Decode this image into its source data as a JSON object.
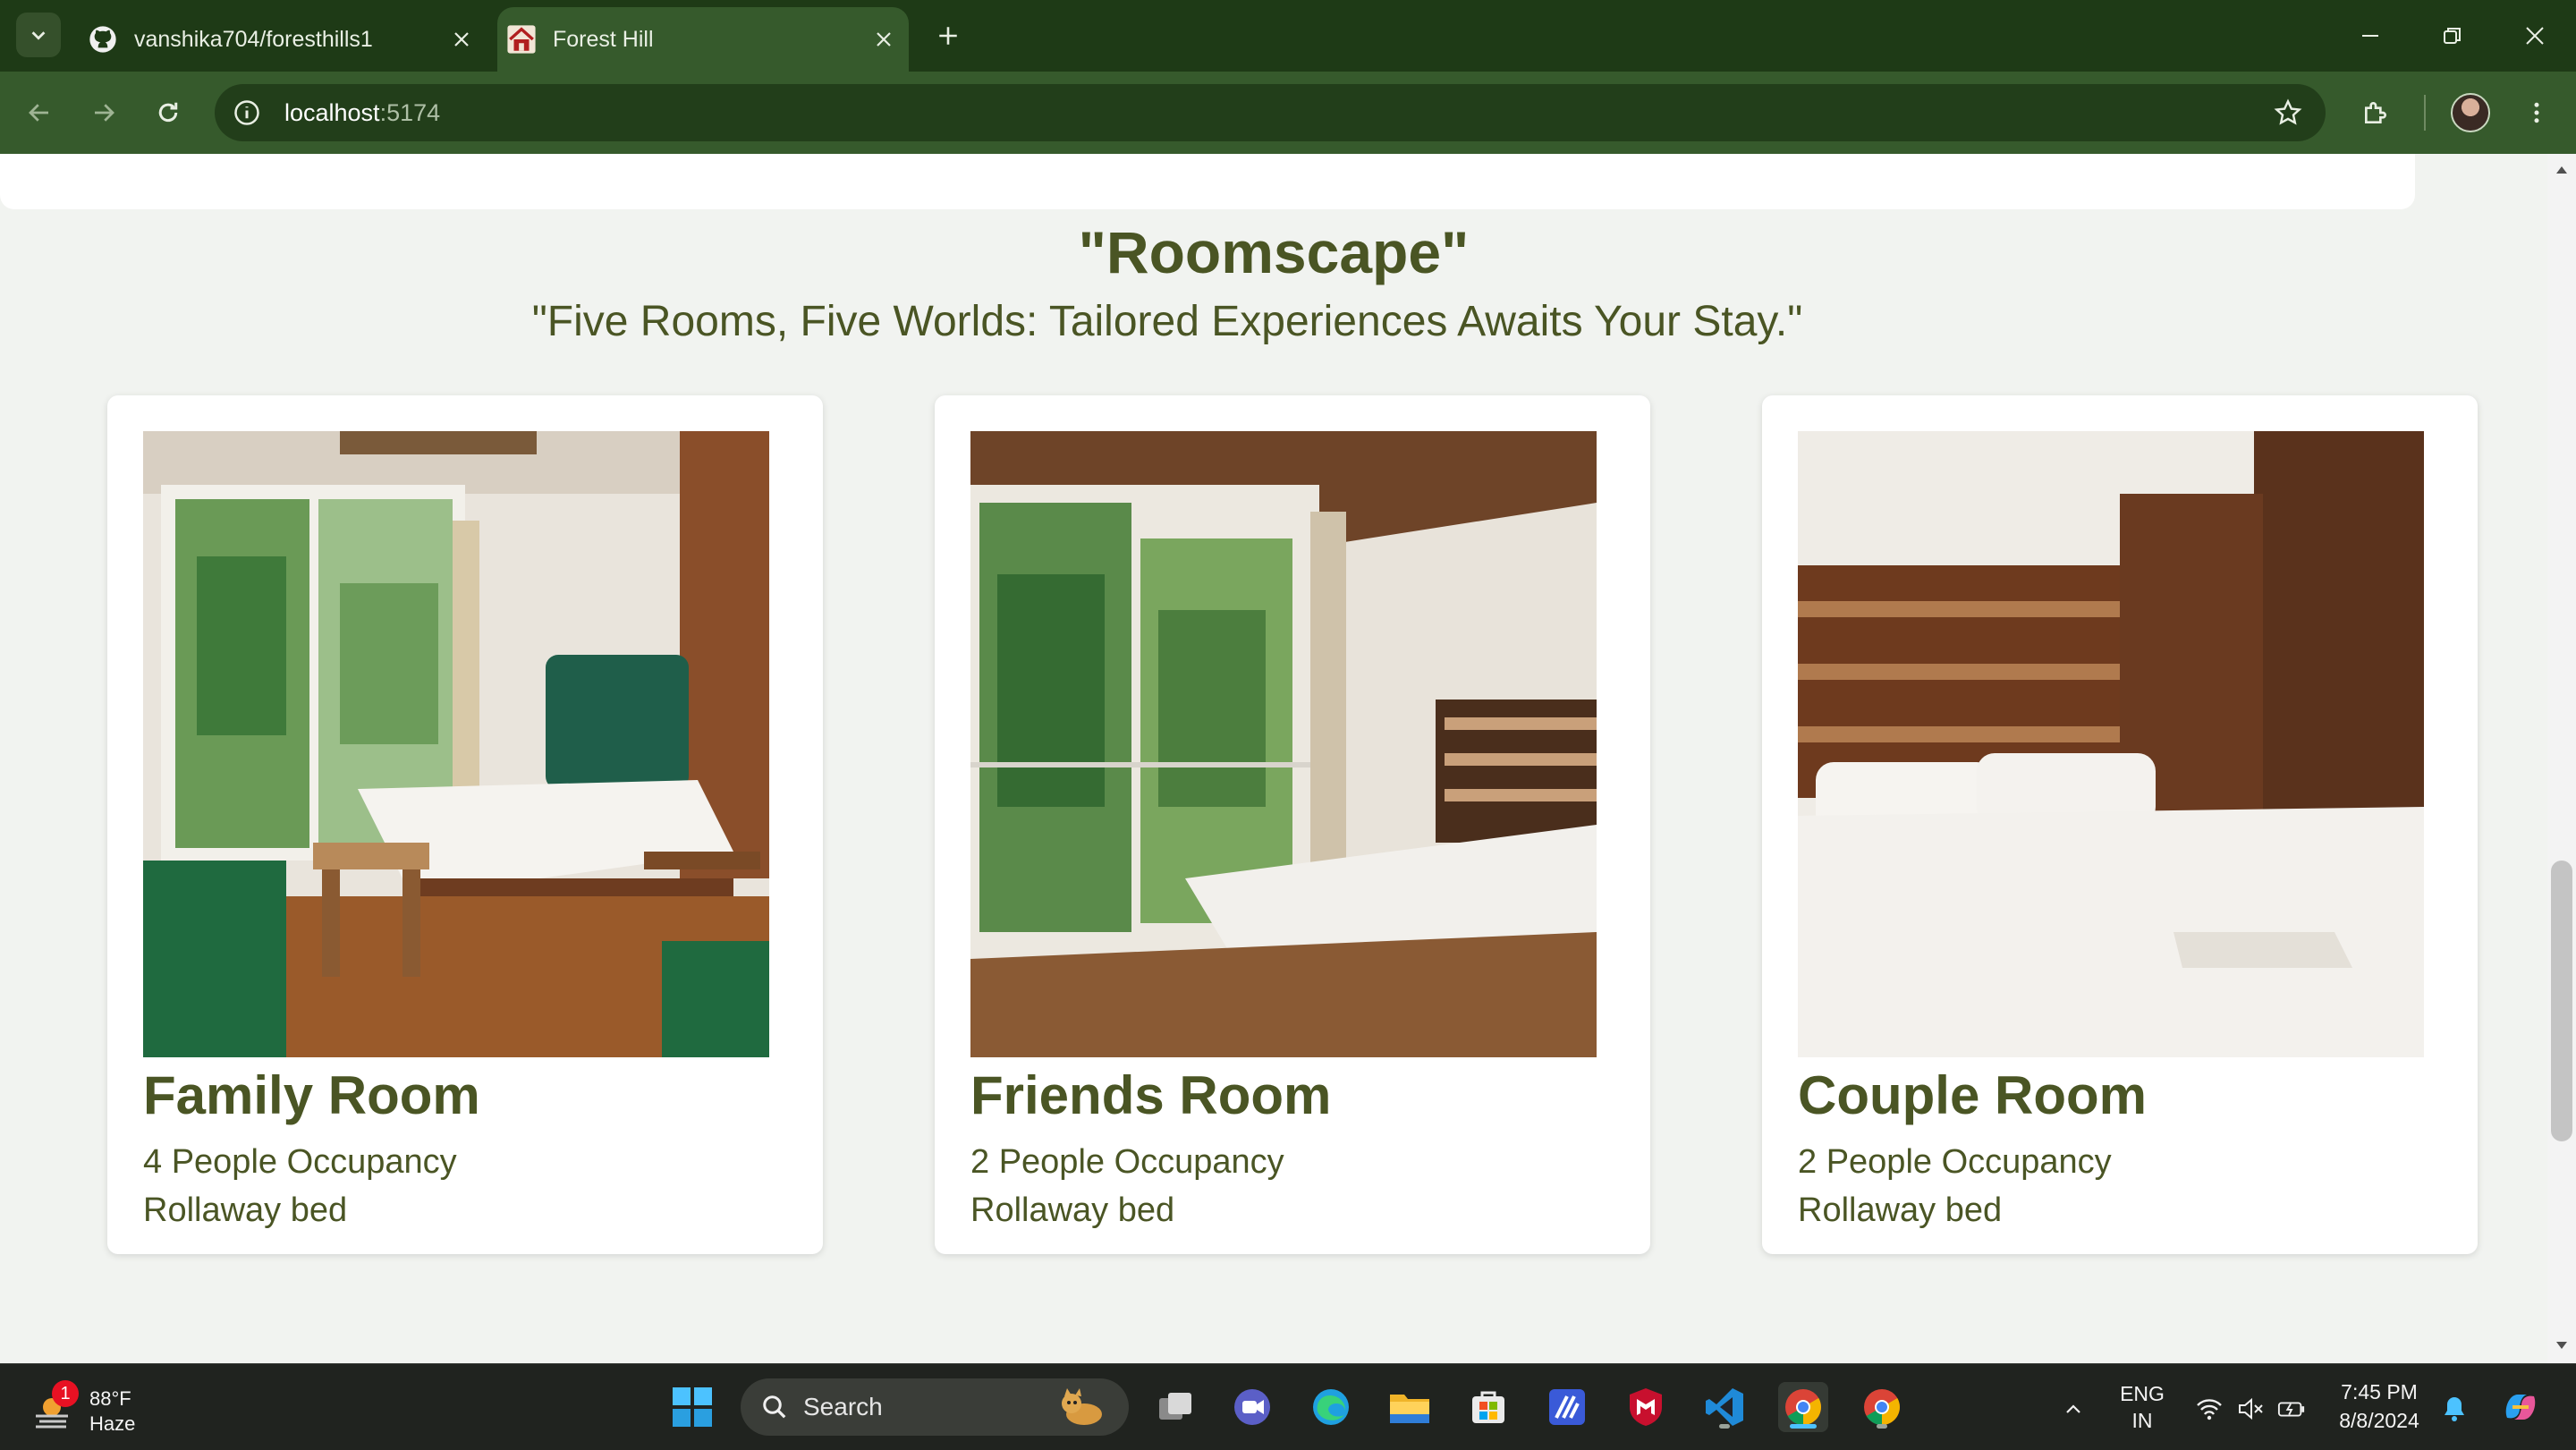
{
  "browser": {
    "tabs": [
      {
        "title": "vanshika704/foresthills1",
        "icon": "github-icon",
        "active": false
      },
      {
        "title": "Forest Hill",
        "icon": "house-icon",
        "active": true
      }
    ],
    "url_host": "localhost",
    "url_port": ":5174"
  },
  "page": {
    "heading": "\"Roomscape\"",
    "subheading": "\"Five Rooms, Five Worlds: Tailored Experiences Awaits Your Stay.\"",
    "rooms": [
      {
        "title": "Family Room",
        "occupancy": "4 People Occupancy",
        "bed": "Rollaway bed"
      },
      {
        "title": "Friends Room",
        "occupancy": "2 People Occupancy",
        "bed": "Rollaway bed"
      },
      {
        "title": "Couple Room",
        "occupancy": "2 People Occupancy",
        "bed": "Rollaway bed"
      }
    ],
    "accent_color": "#4a5524"
  },
  "taskbar": {
    "weather": {
      "badge": "1",
      "temp": "88°F",
      "condition": "Haze"
    },
    "search_placeholder": "Search",
    "apps": [
      "start-icon",
      "task-view-icon",
      "meet-icon",
      "edge-icon",
      "file-explorer-icon",
      "store-icon",
      "vscode-insiders-icon",
      "mcafee-icon",
      "vscode-icon",
      "chrome-icon",
      "chrome-icon"
    ],
    "language": {
      "line1": "ENG",
      "line2": "IN"
    },
    "clock": {
      "time": "7:45 PM",
      "date": "8/8/2024"
    }
  }
}
